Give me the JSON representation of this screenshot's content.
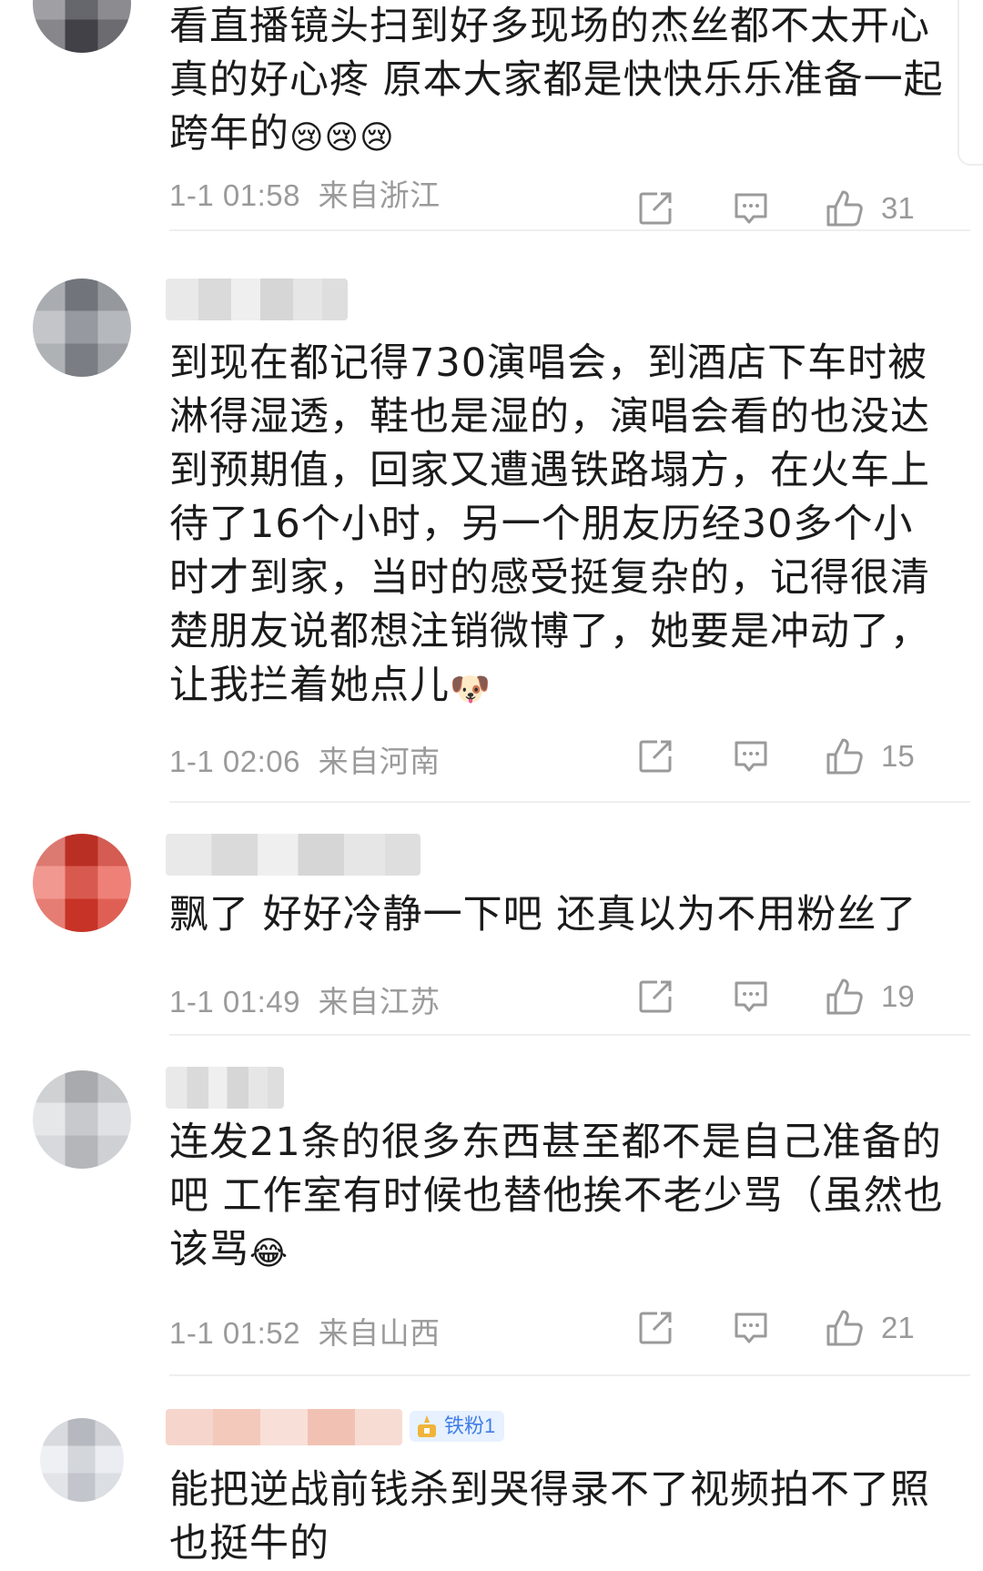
{
  "comments": [
    {
      "text": "看直播镜头扫到好多现场的杰丝都不太开心真的好心疼 原本大家都是快快乐乐准备一起跨年的",
      "emojis": [
        "😢",
        "😢",
        "😢"
      ],
      "time": "1-1 01:58",
      "location": "来自浙江",
      "likes": "31",
      "avatar_color": "#4a4a52"
    },
    {
      "text": "到现在都记得730演唱会，到酒店下车时被淋得湿透，鞋也是湿的，演唱会看的也没达到预期值，回家又遭遇铁路塌方，在火车上待了16个小时，另一个朋友历经30多个小时才到家，当时的感受挺复杂的，记得很清楚朋友说都想注销微博了，她要是冲动了，让我拦着她点儿",
      "emojis": [
        "🐶"
      ],
      "time": "1-1 02:06",
      "location": "来自河南",
      "likes": "15",
      "avatar_color": "#8c9097"
    },
    {
      "text": "飘了 好好冷静一下吧 还真以为不用粉丝了",
      "emojis": [],
      "time": "1-1 01:49",
      "location": "来自江苏",
      "likes": "19",
      "avatar_color": "#e53a2c"
    },
    {
      "text": "连发21条的很多东西甚至都不是自己准备的吧 工作室有时候也替他挨不老少骂（虽然也该骂",
      "emojis": [
        "😂"
      ],
      "time": "1-1 01:52",
      "location": "来自山西",
      "likes": "21",
      "avatar_color": "#cfd1d5"
    },
    {
      "text": "能把逆战前钱杀到哭得录不了视频拍不了照也挺牛的",
      "emojis": [],
      "badge": "铁粉1",
      "avatar_color": "#dfe3ea"
    }
  ],
  "icons": {
    "share": "share-icon",
    "comment": "comment-icon",
    "like": "like-icon"
  },
  "colors": {
    "text": "#1b1b1b",
    "meta": "#9a9a9a",
    "badge_bg": "#e7f1ff",
    "badge_text": "#3f7ee8"
  }
}
